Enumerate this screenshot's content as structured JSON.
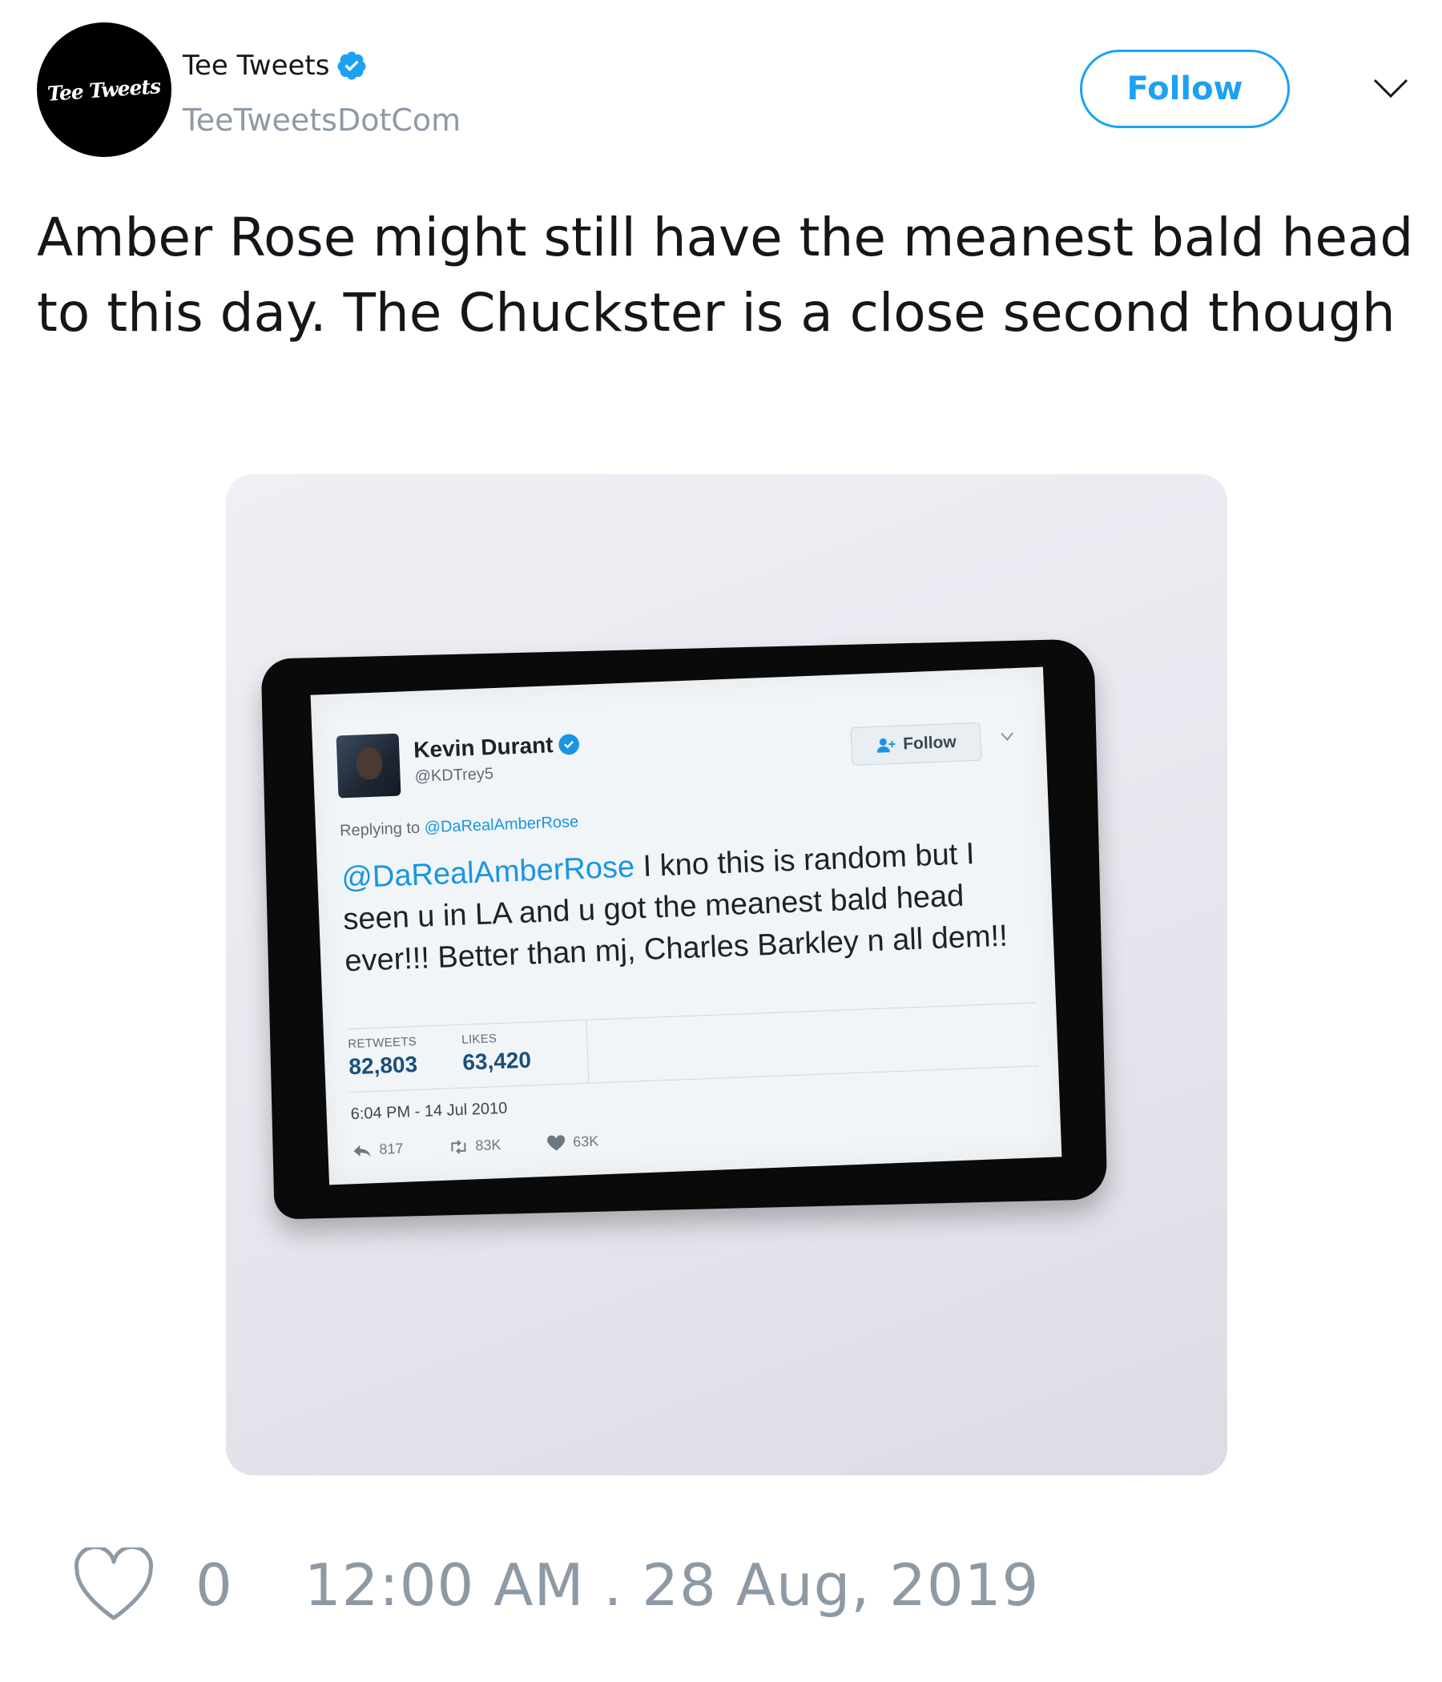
{
  "header": {
    "avatar_text": "Tee Tweets",
    "display_name": "Tee Tweets",
    "handle": "TeeTweetsDotCom",
    "follow_label": "Follow",
    "more_icon": "chevron-down-icon",
    "verified_icon": "verified-badge-icon"
  },
  "tweet": {
    "text": "Amber Rose might still have the meanest bald head to this day. The Chuckster is a close second though"
  },
  "media": {
    "printed_tweet": {
      "name": "Kevin Durant",
      "handle": "@KDTrey5",
      "follow_label": "Follow",
      "replying_prefix": "Replying to",
      "replying_to": "@DaRealAmberRose",
      "body_mention": "@DaRealAmberRose",
      "body_text": " I kno this is random but I seen u in LA and u got the meanest bald head ever!!! Better than mj, Charles Barkley n all dem!!",
      "retweets_label": "RETWEETS",
      "retweets_value": "82,803",
      "likes_label": "LIKES",
      "likes_value": "63,420",
      "timestamp": "6:04 PM - 14 Jul 2010",
      "reply_count": "817",
      "retweet_count": "83K",
      "like_count": "63K"
    }
  },
  "footer": {
    "like_count": "0",
    "timestamp": "12:00 AM . 28 Aug, 2019",
    "like_icon": "heart-icon"
  },
  "colors": {
    "accent": "#1da1f2",
    "muted_text": "#8d9aa6",
    "primary_text": "#14171a"
  }
}
